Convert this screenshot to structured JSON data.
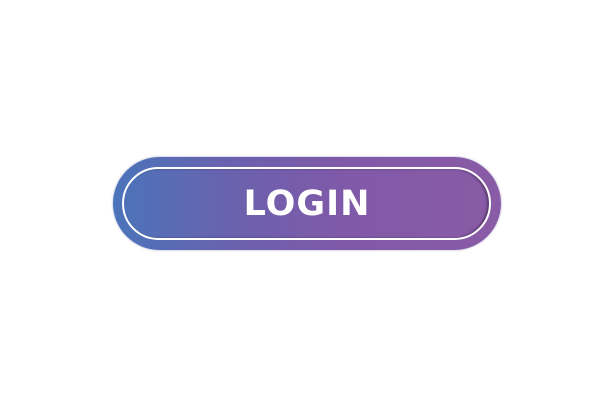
{
  "login_button": {
    "label": "LOGIN",
    "gradient_start": "#4a74ba",
    "gradient_end": "#8a5ba6",
    "text_color": "#ffffff"
  }
}
